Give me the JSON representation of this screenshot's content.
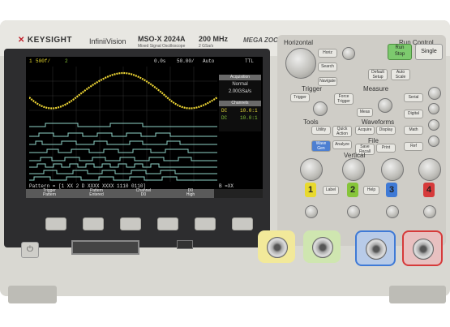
{
  "brand": {
    "name": "KEYSIGHT",
    "series": "InfiniiVision",
    "model": "MSO-X 2024A",
    "model_sub": "Mixed Signal Oscilloscope",
    "bandwidth": "200 MHz",
    "sample": "2 GSa/s",
    "mega": "MEGA ZOOM"
  },
  "screen": {
    "status": {
      "ch1": "1",
      "ch1_scale": "500f/",
      "ch2": "2",
      "time_pos": "0.0s",
      "time_scale": "50.00/",
      "trig_mode": "Auto",
      "trig_level": "TTL"
    },
    "acq_title": "Acquisition",
    "acq_mode": "Normal",
    "acq_rate": "2.00GSa/s",
    "chan_title": "Channels",
    "chan_rows": [
      {
        "label": "DC",
        "value": "10.0:1"
      },
      {
        "label": "DC",
        "value": "10.0:1"
      }
    ],
    "digital_labels": [
      "D7",
      "D6",
      "D5",
      "D4",
      "D3",
      "D2",
      "D1",
      "D0"
    ],
    "pattern_line": "Pattern = [1 XX 2 D  XXXX XXXX 1110 0110]",
    "pattern_right": "B  =XX",
    "softkeys": [
      {
        "top": "Trigger",
        "bottom": "Pattern"
      },
      {
        "top": "Pattern",
        "bottom": "Entered"
      },
      {
        "top": "Channel",
        "bottom": "D0"
      },
      {
        "top": "D0",
        "bottom": "High"
      }
    ]
  },
  "panel": {
    "horizontal": "Horizontal",
    "run_control": "Run Control",
    "run_stop": "Run\nStop",
    "single": "Single",
    "trigger": "Trigger",
    "measure": "Measure",
    "tools": "Tools",
    "waveforms": "Waveforms",
    "file": "File",
    "vertical": "Vertical",
    "buttons": {
      "horiz": "Horiz",
      "search": "Search",
      "navigate": "Navigate",
      "default": "Default Setup",
      "auto": "Auto Scale",
      "trigger": "Trigger",
      "force": "Force Trigger",
      "cursors": "Cursors",
      "meas": "Meas",
      "utility": "Utility",
      "quick": "Quick Action",
      "acquire": "Acquire",
      "display": "Display",
      "wave": "Wave Gen",
      "analyze": "Analyze",
      "save": "Save Recall",
      "print": "Print",
      "serial": "Serial",
      "digital": "Digital",
      "math": "Math",
      "ref": "Ref",
      "label": "Label",
      "help": "Help",
      "level": "Level",
      "back": "Back Up"
    },
    "channels": [
      "1",
      "2",
      "3",
      "4"
    ]
  },
  "colors": {
    "ch1": "#e8d92d",
    "ch2": "#86c53a",
    "ch3": "#3f7ad6",
    "ch4": "#d63a3a",
    "trace1": "#eed634",
    "digital": "#8fd3c9"
  },
  "bottom": {
    "usb_icon": "usb-icon",
    "power_icon": "power-icon"
  }
}
